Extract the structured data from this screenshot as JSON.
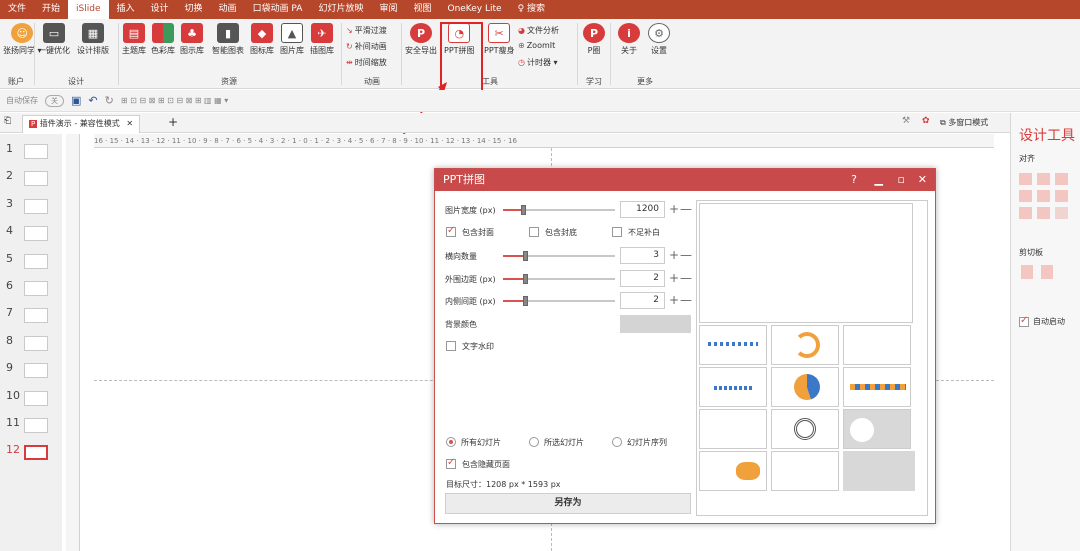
{
  "tabs": [
    "文件",
    "开始",
    "iSlide",
    "插入",
    "设计",
    "切换",
    "动画",
    "口袋动画 PA",
    "幻灯片放映",
    "审阅",
    "视图",
    "OneKey Lite",
    "搜索"
  ],
  "ribbon": {
    "account_btn": "张扬同学 ▾",
    "account_group": "账户",
    "optimize_btn": "一键优化",
    "layout_btn": "设计排版",
    "design_group": "设计",
    "lib_btns": [
      "主题库",
      "色彩库",
      "图示库",
      "智能图表",
      "图标库",
      "图片库",
      "插图库"
    ],
    "res_group": "资源",
    "anim_items": [
      "平滑过渡",
      "补间动画",
      "时间缩放"
    ],
    "anim_group": "动画",
    "export_btn": "安全导出",
    "stitch_btn": "PPT拼图",
    "slim_btn": "PPT瘦身",
    "tool_items": [
      "文件分析",
      "ZoomIt",
      "计时器 ▾"
    ],
    "tool_group": "工具",
    "pcircle_btn": "P圈",
    "learn_group": "学习",
    "about_btn": "关于",
    "settings_btn": "设置",
    "more_group": "更多"
  },
  "qat": {
    "autosave": "自动保存",
    "autosave_state": "关"
  },
  "doc_tab": "插件演示 - 兼容性模式",
  "multiwin": "多窗口模式",
  "ruler_text": "16 · 15 · 14 · 13 · 12 · 11 · 10 · 9 · 8 · 7 · 6 · 5 · 4 · 3 · 2 · 1 · 0 · 1 · 2 · 3 · 4 · 5 · 6 · 7 · 8 · 9 · 10 · 11 · 12 · 13 · 14 · 15 · 16",
  "slides": [
    "1",
    "2",
    "3",
    "4",
    "5",
    "6",
    "7",
    "8",
    "9",
    "10",
    "11",
    "12"
  ],
  "right_panel": {
    "title": "设计工具",
    "align": "对齐",
    "clipboard": "剪切板",
    "autostart": "自动启动"
  },
  "dialog": {
    "title": "PPT拼图",
    "help": "?",
    "img_width_label": "图片宽度 (px)",
    "img_width_val": "1200",
    "include_cover": "包含封面",
    "include_back": "包含封底",
    "fill_blank": "不足补白",
    "cols_label": "横向数量",
    "cols_val": "3",
    "outer_label": "外围边距 (px)",
    "outer_val": "2",
    "inner_label": "内侧间距 (px)",
    "inner_val": "2",
    "bg_label": "背景颜色",
    "watermark": "文字水印",
    "radio_all": "所有幻灯片",
    "radio_selected": "所选幻灯片",
    "radio_seq": "幻灯片序列",
    "include_hidden": "包含隐藏页面",
    "target_size": "目标尺寸：1208 px * 1593 px",
    "save_as": "另存为"
  },
  "colors": {
    "brand": "#b7472a",
    "dialog": "#c94a4a",
    "accent": "#d9534f",
    "islide_red": "#d83b3b",
    "orange": "#f0a13c",
    "blue": "#3c78c8"
  },
  "icons": [
    "add-icon",
    "minus-icon",
    "close-icon",
    "maximize-icon",
    "minimize-icon",
    "undo-icon",
    "save-icon",
    "search-icon"
  ]
}
